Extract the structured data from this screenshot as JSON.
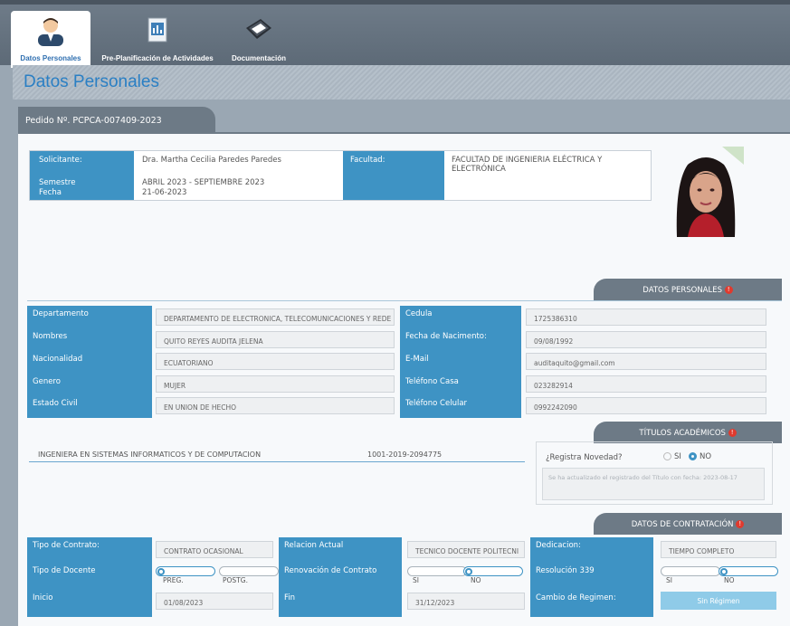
{
  "tabs": [
    {
      "label": "Datos Personales",
      "icon": "user-icon",
      "active": true
    },
    {
      "label": "Pre-Planificación de Actividades",
      "icon": "clipboard-chart-icon",
      "active": false
    },
    {
      "label": "Documentación",
      "icon": "documents-icon",
      "active": false
    }
  ],
  "page_title": "Datos Personales",
  "pedido": "Pedido Nº. PCPCA-007409-2023",
  "solicitud": {
    "solicitante_label": "Solicitante:",
    "solicitante_value": "Dra. Martha Cecilia Paredes Paredes",
    "semestre_label": "Semestre",
    "semestre_value": "ABRIL 2023 - SEPTIEMBRE 2023",
    "fecha_label": "Fecha",
    "fecha_value": "21-06-2023",
    "facultad_label": "Facultad:",
    "facultad_value": "FACULTAD DE INGENIERIA ELÉCTRICA Y ELECTRÓNICA"
  },
  "datos_personales": {
    "header": "DATOS PERSONALES",
    "badge": "!",
    "left": [
      {
        "label": "Departamento",
        "value": "DEPARTAMENTO DE ELECTRONICA, TELECOMUNICACIONES Y REDE"
      },
      {
        "label": "Nombres",
        "value": "QUITO REYES AUDITA JELENA"
      },
      {
        "label": "Nacionalidad",
        "value": "ECUATORIANO"
      },
      {
        "label": "Genero",
        "value": "MUJER"
      },
      {
        "label": "Estado Civil",
        "value": "EN UNION DE HECHO"
      }
    ],
    "right": [
      {
        "label": "Cedula",
        "value": "1725386310"
      },
      {
        "label": "Fecha de Nacimento:",
        "value": "09/08/1992"
      },
      {
        "label": "E-Mail",
        "value": "auditaquito@gmail.com"
      },
      {
        "label": "Teléfono Casa",
        "value": "023282914"
      },
      {
        "label": "Teléfono Celular",
        "value": "0992242090"
      }
    ]
  },
  "titulos": {
    "header": "TÍTULOS ACADÉMICOS",
    "badge": "!",
    "titulo": "INGENIERA EN SISTEMAS INFORMATICOS Y DE COMPUTACION",
    "registro": "1001-2019-2094775",
    "novedad_label": "¿Registra Novedad?",
    "si": "SI",
    "no": "NO",
    "nota": "Se ha actualizado el registrado del Título con fecha: 2023-08-17"
  },
  "contratacion": {
    "header": "DATOS DE CONTRATACIÓN",
    "badge": "!",
    "tipo_contrato_label": "Tipo de Contrato:",
    "tipo_contrato_value": "CONTRATO OCASIONAL",
    "tipo_docente_label": "Tipo de Docente",
    "preg": "PREG.",
    "postg": "POSTG.",
    "inicio_label": "Inicio",
    "inicio_value": "01/08/2023",
    "relacion_label": "Relacion Actual",
    "relacion_value": "TECNICO DOCENTE POLITECNI",
    "renovacion_label": "Renovación de Contrato",
    "si": "SI",
    "no": "NO",
    "fin_label": "Fin",
    "fin_value": "31/12/2023",
    "dedicacion_label": "Dedicacion:",
    "dedicacion_value": "TIEMPO COMPLETO",
    "resolucion_label": "Resolución 339",
    "res_si": "SI",
    "res_no": "NO",
    "cambio_label": "Cambio de Regimen:",
    "cambio_button": "Sin Régimen"
  }
}
